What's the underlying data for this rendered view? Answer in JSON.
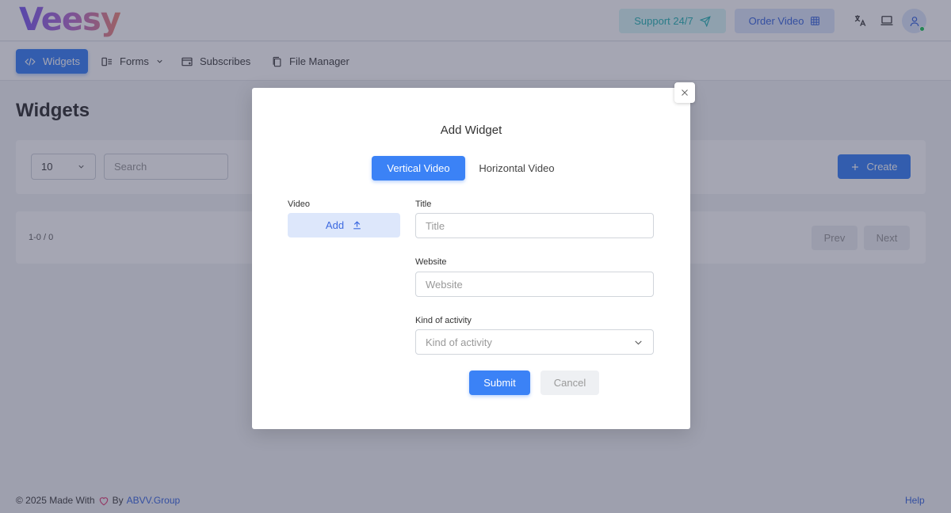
{
  "header": {
    "logo_text": "Veesy",
    "support_label": "Support 24/7",
    "order_label": "Order Video",
    "icons": [
      "translate-icon",
      "laptop-icon",
      "user-icon"
    ]
  },
  "nav": {
    "items": [
      {
        "label": "Widgets",
        "icon": "code-icon",
        "active": true
      },
      {
        "label": "Forms",
        "icon": "forms-icon",
        "active": false
      },
      {
        "label": "Subscribes",
        "icon": "subscribes-icon",
        "active": false
      },
      {
        "label": "File Manager",
        "icon": "files-icon",
        "active": false
      }
    ]
  },
  "page": {
    "title": "Widgets",
    "page_size": "10",
    "search_placeholder": "Search",
    "create_label": "Create",
    "range_text": "1-0 / 0",
    "prev_label": "Prev",
    "next_label": "Next"
  },
  "footer": {
    "copyright": "© 2025 Made With",
    "by": "By",
    "company": "ABVV.Group",
    "help": "Help"
  },
  "modal": {
    "title": "Add Widget",
    "tabs": [
      {
        "label": "Vertical Video",
        "active": true
      },
      {
        "label": "Horizontal Video",
        "active": false
      }
    ],
    "video_label": "Video",
    "add_label": "Add",
    "title_label": "Title",
    "title_placeholder": "Title",
    "website_label": "Website",
    "website_placeholder": "Website",
    "activity_label": "Kind of activity",
    "activity_placeholder": "Kind of activity",
    "submit_label": "Submit",
    "cancel_label": "Cancel"
  },
  "colors": {
    "primary": "#3b82f6",
    "support_bg": "#d9f7f6",
    "support_text": "#2bb6b6",
    "overlay": "rgba(40,44,74,0.42)"
  }
}
